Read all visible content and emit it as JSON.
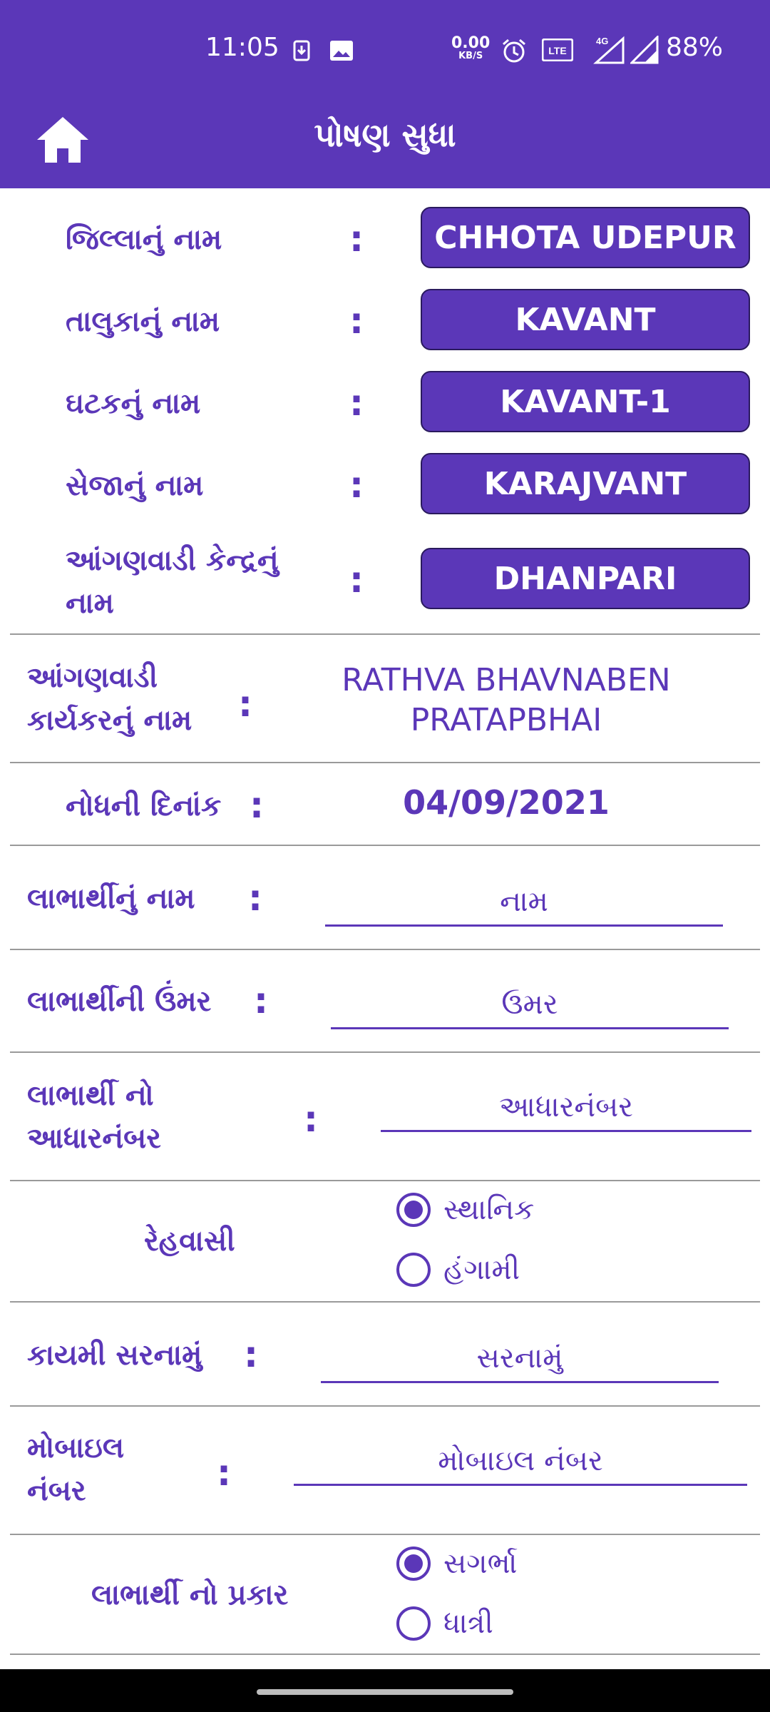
{
  "status_bar": {
    "time": "11:05",
    "net_speed": "0.00",
    "net_unit": "KB/S",
    "battery": "88%",
    "icons": [
      "download-icon",
      "image-icon",
      "alarm-icon",
      "volte-icon",
      "signal-4g-icon",
      "signal-icon"
    ]
  },
  "app_bar": {
    "title": "પોષણ સુધા",
    "home_icon": "home-icon"
  },
  "location": {
    "district_label": "જિલ્લાનું નામ",
    "district_value": "CHHOTA UDEPUR",
    "taluka_label": "તાલુકાનું નામ",
    "taluka_value": "KAVANT",
    "unit_label": "ઘટકનું નામ",
    "unit_value": "KAVANT-1",
    "seja_label": "સેજાનું નામ",
    "seja_value": "KARAJVANT",
    "awc_label_1": "આંગણવાડી કેન્દ્રનું",
    "awc_label_2": "નામ",
    "awc_value": "DHANPARI",
    "colon": ":"
  },
  "worker": {
    "label_1": "આંગણવાડી",
    "label_2": "કાર્યકરનું નામ",
    "value_1": "RATHVA BHAVNABEN",
    "value_2": "PRATAPBHAI"
  },
  "registration_date": {
    "label": "નોધની દિનાંક",
    "value": "04/09/2021"
  },
  "beneficiary_name": {
    "label": "લાભાર્થીનું નામ",
    "placeholder": "નામ"
  },
  "beneficiary_age": {
    "label": "લાભાર્થીની ઉંમર",
    "placeholder": "ઉંમર"
  },
  "aadhaar": {
    "label_1": "લાભાર્થી નો",
    "label_2": "આધારનંબર",
    "placeholder": "આધારનંબર"
  },
  "residence": {
    "label": "રેહવાસી",
    "options": [
      "સ્થાનિક",
      "હંગામી"
    ],
    "selected": "સ્થાનિક"
  },
  "address": {
    "label": "કાયમી સરનામું",
    "placeholder": "સરનામું"
  },
  "mobile": {
    "label_1": "મોબાઇલ",
    "label_2": "નંબર",
    "placeholder": "મોબાઇલ નંબર"
  },
  "beneficiary_type": {
    "label": "લાભાર્થી નો પ્રકાર",
    "options": [
      "સગર્ભા",
      "ધાત્રી"
    ],
    "selected": "સગર્ભા"
  },
  "theme": {
    "primary": "#5b37b8",
    "divider": "#9a9a9a"
  }
}
